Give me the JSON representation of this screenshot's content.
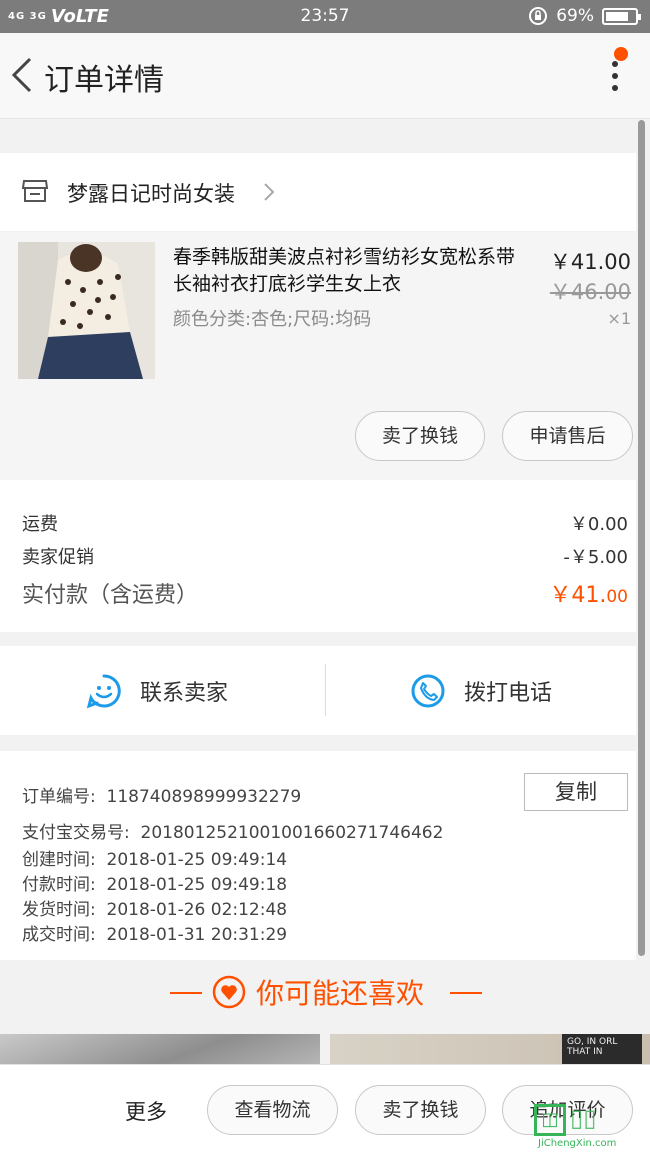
{
  "status_bar": {
    "signal": "4G 3G",
    "network": "VoLTE",
    "time": "23:57",
    "battery": "69%"
  },
  "header": {
    "title": "订单详情"
  },
  "shop": {
    "name": "梦露日记时尚女装"
  },
  "product": {
    "name": "春季韩版甜美波点衬衫雪纺衫女宽松系带长袖衬衣打底衫学生女上衣",
    "spec": "颜色分类:杏色;尺码:均码",
    "price": "￥41.00",
    "original_price": "￥46.00",
    "quantity": "×1",
    "buttons": {
      "sell": "卖了换钱",
      "after_sale": "申请售后"
    }
  },
  "fees": {
    "shipping_label": "运费",
    "shipping_value": "￥0.00",
    "promo_label": "卖家促销",
    "promo_value": "-￥5.00",
    "total_label": "实付款（含运费）",
    "total_main": "￥41.",
    "total_cents": "00"
  },
  "contact": {
    "seller": "联系卖家",
    "call": "拨打电话"
  },
  "order_info": {
    "copy_button": "复制",
    "rows": [
      {
        "label": "订单编号:",
        "value": "118740898999932279"
      },
      {
        "label": "支付宝交易号:",
        "value": "2018012521001001660271746462"
      },
      {
        "label": "创建时间:",
        "value": "2018-01-25 09:49:14"
      },
      {
        "label": "付款时间:",
        "value": "2018-01-25 09:49:18"
      },
      {
        "label": "发货时间:",
        "value": "2018-01-26 02:12:48"
      },
      {
        "label": "成交时间:",
        "value": "2018-01-31 20:31:29"
      }
    ]
  },
  "recommend": {
    "title": "你可能还喜欢"
  },
  "recommend_sign": "GO, IN ORL THAT IN",
  "bottom_bar": {
    "more": "更多",
    "logistics": "查看物流",
    "sell": "卖了换钱",
    "review": "追加评价"
  },
  "watermark": {
    "url": "JiChengXin.com"
  },
  "colors": {
    "accent": "#ff5000",
    "blue_icon": "#1e9be8"
  }
}
